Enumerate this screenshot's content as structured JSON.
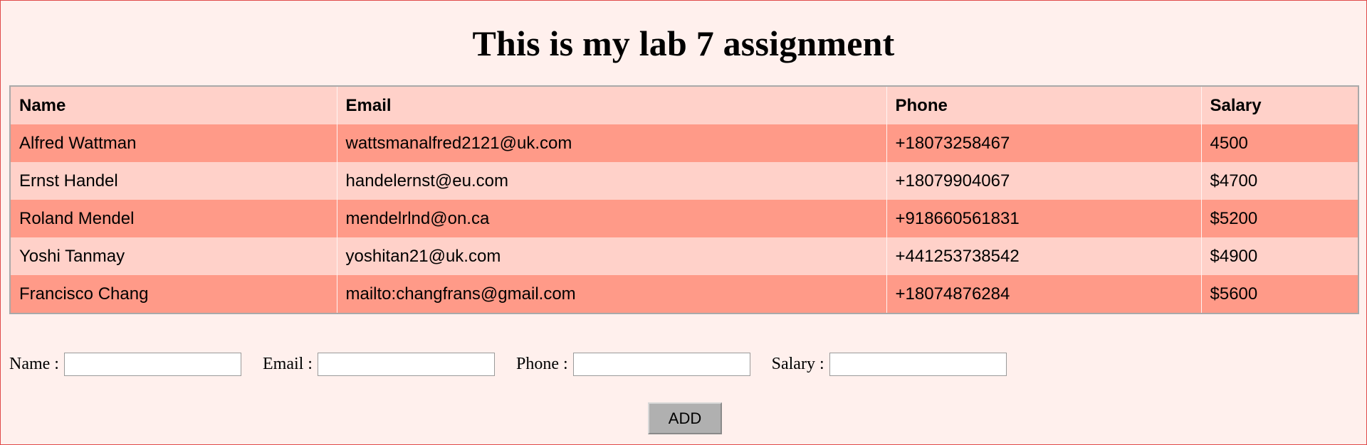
{
  "page": {
    "title": "This is my lab 7 assignment"
  },
  "table": {
    "headers": [
      "Name",
      "Email",
      "Phone",
      "Salary"
    ],
    "rows": [
      [
        "Alfred Wattman",
        "wattsmanalfred2121@uk.com",
        "+18073258467",
        "4500"
      ],
      [
        "Ernst Handel",
        "handelernst@eu.com",
        "+18079904067",
        "$4700"
      ],
      [
        "Roland Mendel",
        "mendelrlnd@on.ca",
        "+918660561831",
        "$5200"
      ],
      [
        "Yoshi Tanmay",
        "yoshitan21@uk.com",
        "+441253738542",
        "$4900"
      ],
      [
        "Francisco Chang",
        "mailto:changfrans@gmail.com",
        "+18074876284",
        "$5600"
      ]
    ]
  },
  "form": {
    "name_label": "Name :",
    "email_label": "Email :",
    "phone_label": "Phone :",
    "salary_label": "Salary :",
    "name_value": "",
    "email_value": "",
    "phone_value": "",
    "salary_value": "",
    "add_label": "ADD"
  },
  "colors": {
    "background": "#fff0ed",
    "header_row": "#ffd1c9",
    "odd_row": "#ff9a88",
    "even_row": "#ffd1c9",
    "border": "#e04a4a"
  }
}
